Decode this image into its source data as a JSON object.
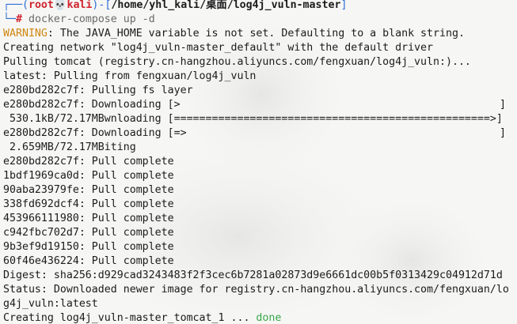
{
  "prompt": {
    "user": "root",
    "skull": "💀",
    "host": "kali",
    "path": "/home/yhl_kali/桌面/log4j_vuln-master",
    "hash": "#",
    "command": "docker-compose up -d",
    "top_left": "┌──(",
    "top_mid": ")-[",
    "top_end": "]",
    "bottom_left": "└─"
  },
  "output": {
    "warn_label": "WARNING",
    "warn_text": ": The JAVA_HOME variable is not set. Defaulting to a blank string.",
    "creating_network": "Creating network \"log4j_vuln-master_default\" with the default driver",
    "pulling_tomcat": "Pulling tomcat (registry.cn-hangzhou.aliyuncs.com/fengxuan/log4j_vuln:)...",
    "latest_pulling": "latest: Pulling from fengxuan/log4j_vuln",
    "fs_layer": "e280bd282c7f: Pulling fs layer",
    "downloading_1_left": "e280bd282c7f: Downloading [>",
    "downloading_1_right": "]",
    "progress_1": " 530.1kB/72.17MBwnloading [==================================================>]",
    "downloading_2_left": "e280bd282c7f: Downloading [=>",
    "downloading_2_right": "]",
    "progress_2": " 2.659MB/72.17MBiting",
    "complete_lines": [
      "e280bd282c7f: Pull complete",
      "1bdf1969ca0d: Pull complete",
      "90aba23979fe: Pull complete",
      "338fd692dcf4: Pull complete",
      "453966111980: Pull complete",
      "c942fbc702d7: Pull complete",
      "9b3ef9d19150: Pull complete",
      "60f46e436224: Pull complete"
    ],
    "digest": "Digest: sha256:d929cad3243483f2f3cec6b7281a02873d9e6661dc00b5f0313429c04912d71d",
    "status_line1": "Status: Downloaded newer image for registry.cn-hangzhou.aliyuncs.com/fengxuan/lo",
    "status_line2": "g4j_vuln:latest",
    "creating_container": "Creating log4j_vuln-master_tomcat_1 ... ",
    "done": "done"
  },
  "colors": {
    "background": "#f6f6f5",
    "user": "#d0242e",
    "frame": "#2b6fd6",
    "warning": "#d0860f",
    "done": "#3aa84a",
    "command": "#6b6b6b"
  }
}
